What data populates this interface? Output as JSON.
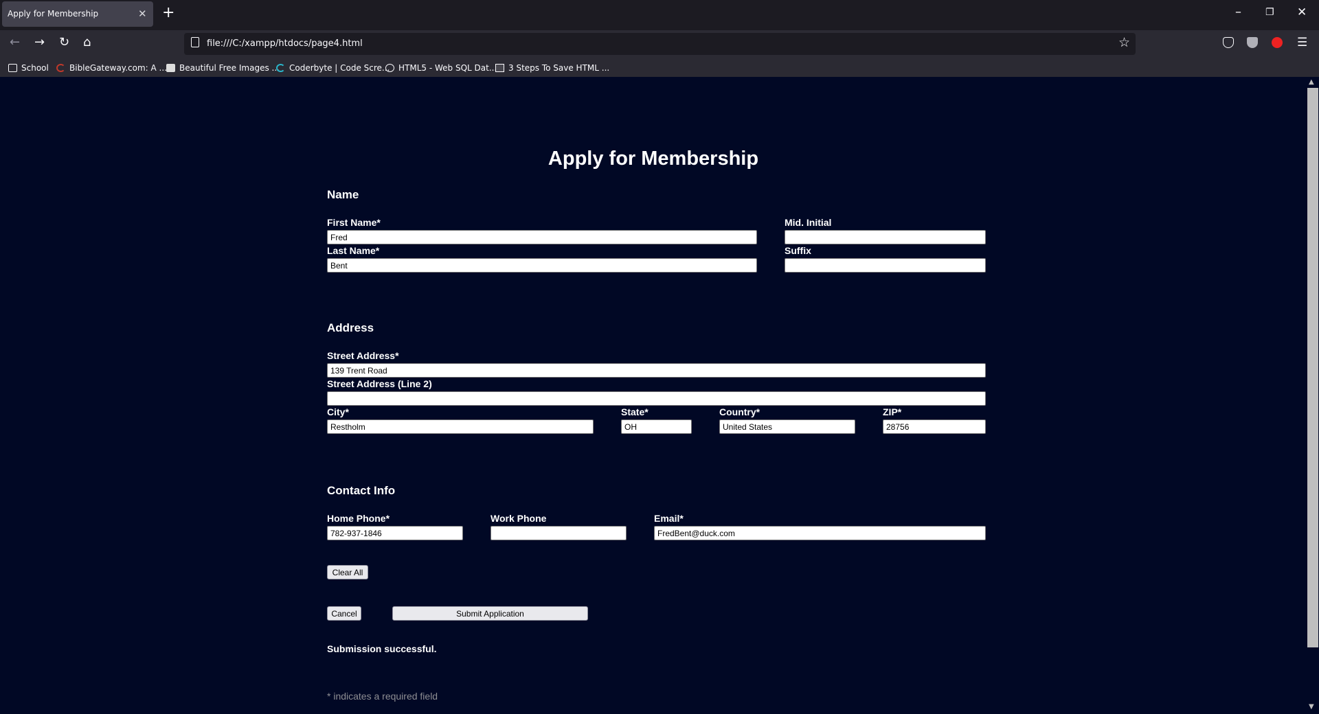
{
  "browser": {
    "tab_title": "Apply for Membership",
    "tab_close": "✕",
    "new_tab": "+",
    "url": "file:///C:/xampp/htdocs/page4.html",
    "bookmarks": [
      {
        "label": "School",
        "icon": "folder-icon"
      },
      {
        "label": "BibleGateway.com: A ...",
        "icon": "biblegateway-icon"
      },
      {
        "label": "Beautiful Free Images ...",
        "icon": "unsplash-icon"
      },
      {
        "label": "Coderbyte | Code Scre...",
        "icon": "coderbyte-icon"
      },
      {
        "label": "HTML5 - Web SQL Dat...",
        "icon": "globe-icon"
      },
      {
        "label": "3 Steps To Save HTML ...",
        "icon": "box-icon"
      }
    ]
  },
  "form": {
    "title": "Apply for Membership",
    "name_section": {
      "heading": "Name",
      "first_name_label": "First Name*",
      "first_name_value": "Fred",
      "mid_initial_label": "Mid. Initial",
      "mid_initial_value": "",
      "last_name_label": "Last Name*",
      "last_name_value": "Bent",
      "suffix_label": "Suffix",
      "suffix_value": ""
    },
    "address_section": {
      "heading": "Address",
      "street_label": "Street Address*",
      "street_value": "139 Trent Road",
      "street2_label": "Street Address (Line 2)",
      "street2_value": "",
      "city_label": "City*",
      "city_value": "Restholm",
      "state_label": "State*",
      "state_value": "OH",
      "country_label": "Country*",
      "country_value": "United States",
      "zip_label": "ZIP*",
      "zip_value": "28756"
    },
    "contact_section": {
      "heading": "Contact Info",
      "home_phone_label": "Home Phone*",
      "home_phone_value": "782-937-1846",
      "work_phone_label": "Work Phone",
      "work_phone_value": "",
      "email_label": "Email*",
      "email_value": "FredBent@duck.com"
    },
    "buttons": {
      "clear_all": "Clear All",
      "cancel": "Cancel",
      "submit": "Submit Application"
    },
    "status_message": "Submission successful.",
    "required_note": "* indicates a required field"
  }
}
